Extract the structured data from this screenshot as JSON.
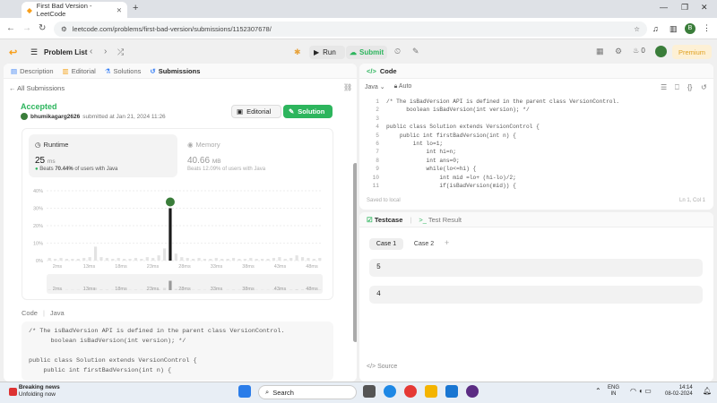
{
  "browser": {
    "tab_title": "First Bad Version - LeetCode",
    "url": "leetcode.com/problems/first-bad-version/submissions/1152307678/"
  },
  "topbar": {
    "problem_list": "Problem List",
    "run": "Run",
    "submit": "Submit",
    "streak": "0",
    "premium": "Premium"
  },
  "left_tabs": [
    "Description",
    "Editorial",
    "Solutions",
    "Submissions"
  ],
  "submission": {
    "back": "All Submissions",
    "status": "Accepted",
    "user": "bhumikagarg2626",
    "submitted": "submitted at Jan 21, 2024 11:26",
    "editorial_btn": "Editorial",
    "solution_btn": "Solution",
    "runtime_label": "Runtime",
    "runtime_value": "25",
    "runtime_unit": "ms",
    "runtime_beats_prefix": "Beats",
    "runtime_beats": "70.44%",
    "runtime_beats_suffix": "of users with Java",
    "memory_label": "Memory",
    "memory_value": "40.66",
    "memory_unit": "MB",
    "memory_beats": "Beats 12.09% of users with Java",
    "code_label": "Code",
    "code_lang": "Java"
  },
  "chart_data": {
    "type": "bar",
    "y_ticks": [
      "40%",
      "30%",
      "20%",
      "10%",
      "0%"
    ],
    "ylim": [
      0,
      40
    ],
    "x_ticks": [
      "2ms",
      "13ms",
      "18ms",
      "23ms",
      "28ms",
      "33ms",
      "38ms",
      "43ms",
      "48ms"
    ],
    "highlight_x": "25ms",
    "highlight_value": 30,
    "bars": [
      1.5,
      1,
      1.5,
      1,
      1,
      1,
      1.5,
      2,
      8,
      2,
      1.5,
      1,
      1.5,
      1,
      1,
      1.5,
      1,
      2,
      1.5,
      3,
      7,
      30,
      4,
      2,
      1.5,
      1,
      1.5,
      1,
      1,
      1.5,
      1,
      1,
      1.5,
      1,
      1,
      1.5,
      1,
      1,
      1,
      1.5,
      2,
      1,
      1.5,
      3,
      2,
      1.5,
      1,
      1.5
    ]
  },
  "code_preview": [
    "/* The isBadVersion API is defined in the parent class VersionControl.",
    "      boolean isBadVersion(int version); */",
    "",
    "public class Solution extends VersionControl {",
    "    public int firstBadVersion(int n) {"
  ],
  "editor": {
    "title": "Code",
    "lang": "Java",
    "mode": "Auto",
    "lines": [
      "/* The isBadVersion API is defined in the parent class VersionControl.",
      "      boolean isBadVersion(int version); */",
      "",
      "public class Solution extends VersionControl {",
      "    public int firstBadVersion(int n) {",
      "        int lo=1;",
      "            int hi=n;",
      "            int ans=0;",
      "            while(lo<=hi) {",
      "                int mid =lo+ (hi-lo)/2;",
      "                if(isBadVersion(mid)) {"
    ],
    "line_numbers": [
      "1",
      "2",
      "3",
      "4",
      "5",
      "6",
      "7",
      "8",
      "9",
      "10",
      "11"
    ],
    "saved": "Saved to local",
    "position": "Ln 1, Col 1"
  },
  "testcase": {
    "tab": "Testcase",
    "result_tab": "Test Result",
    "case1": "Case 1",
    "case2": "Case 2",
    "input1": "5",
    "input2": "4",
    "source": "Source"
  },
  "taskbar": {
    "news_title": "Breaking news",
    "news_sub": "Unfolding now",
    "search": "Search",
    "lang1": "ENG",
    "lang2": "IN",
    "time": "14:14",
    "date": "08-02-2024"
  },
  "colors": {
    "accent_green": "#2db55d",
    "highlight_bar": "#1a1a1a",
    "bar": "#e3e3e3"
  }
}
